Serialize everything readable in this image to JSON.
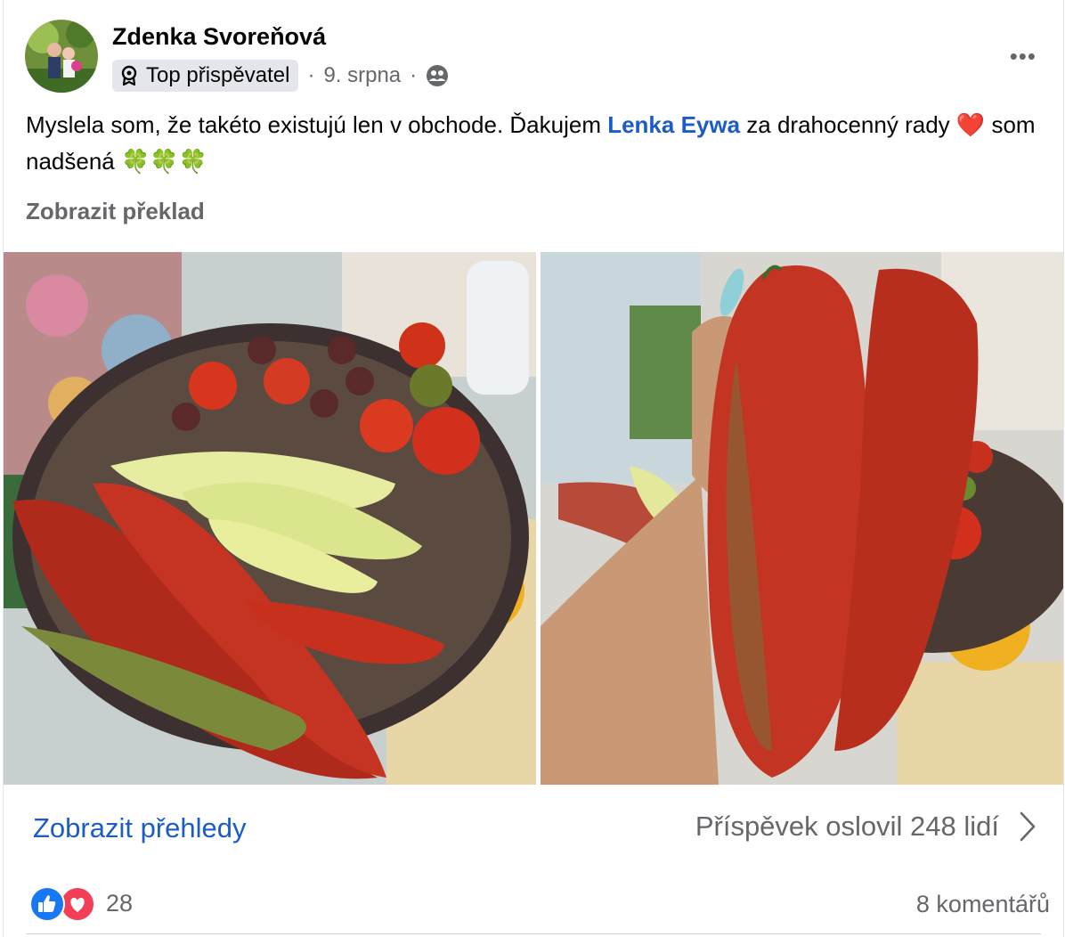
{
  "post": {
    "author": "Zdenka Svoreňová",
    "badge": "Top přispěvatel",
    "separator_1": "·",
    "date": "9. srpna",
    "separator_2": "·",
    "audience_icon": "friends-icon",
    "more_label": "•••",
    "text_part1": "Myslela som, že takéto existujú len v obchode. Ďakujem ",
    "mention": "Lenka Eywa",
    "text_part2": " za drahocenný rady ",
    "heart_emoji": "❤️",
    "text_part3": " som nadšená ",
    "clover_emojis": "🍀🍀🍀",
    "translate_label": "Zobrazit překlad"
  },
  "photos": [
    {
      "description_icon": "basket-of-peppers-and-tomatoes-photo"
    },
    {
      "description_icon": "hand-holding-red-peppers-photo"
    }
  ],
  "footer": {
    "insights_label": "Zobrazit přehledy",
    "reach_label": "Příspěvek oslovil 248 lidí",
    "reaction_count": "28",
    "comments_label": "8 komentářů"
  },
  "colors": {
    "link_blue": "#1b5dc4",
    "secondary_text": "#65676b",
    "like_blue": "#1877f2",
    "love_red": "#f33e58"
  }
}
